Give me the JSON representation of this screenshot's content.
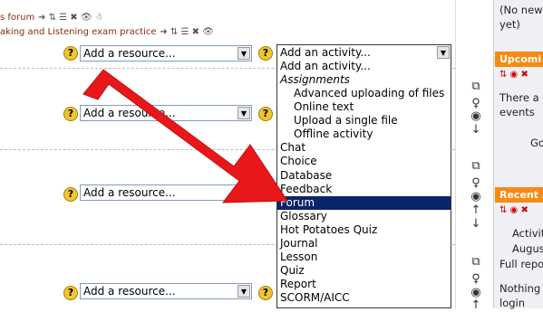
{
  "topbar": {
    "forum_link": "s forum",
    "practice_link": "aking and Listening exam practice",
    "edit_icons": "➜ ⇅ ☰ ✖ 👁",
    "edit_icons_short": "➜ ⇅ ☰ ✖ 👁 ☃"
  },
  "section_rows": [
    {
      "resource_label": "Add a resource...",
      "activity_label": "Add an activity..."
    },
    {
      "resource_label": "Add a resource...",
      "activity_label": "Add an activity..."
    },
    {
      "resource_label": "Add a resource...",
      "activity_label": "Add an activity..."
    },
    {
      "resource_label": "Add a resource...",
      "activity_label": "Add an activity..."
    }
  ],
  "help_symbol": "?",
  "dropdown": {
    "selected": "Add an activity...",
    "options": [
      {
        "label": "Add an activity...",
        "kind": "option"
      },
      {
        "label": "Assignments",
        "kind": "group"
      },
      {
        "label": "Advanced uploading of files",
        "kind": "sub"
      },
      {
        "label": "Online text",
        "kind": "sub"
      },
      {
        "label": "Upload a single file",
        "kind": "sub"
      },
      {
        "label": "Offline activity",
        "kind": "sub"
      },
      {
        "label": "Chat",
        "kind": "option"
      },
      {
        "label": "Choice",
        "kind": "option"
      },
      {
        "label": "Database",
        "kind": "option"
      },
      {
        "label": "Feedback",
        "kind": "option"
      },
      {
        "label": "Forum",
        "kind": "highlighted"
      },
      {
        "label": "Glossary",
        "kind": "option"
      },
      {
        "label": "Hot Potatoes Quiz",
        "kind": "option"
      },
      {
        "label": "Journal",
        "kind": "option"
      },
      {
        "label": "Lesson",
        "kind": "option"
      },
      {
        "label": "Quiz",
        "kind": "option"
      },
      {
        "label": "Report",
        "kind": "option"
      },
      {
        "label": "SCORM/AICC",
        "kind": "option"
      }
    ]
  },
  "right_block": {
    "news_text_1": "(No new",
    "news_text_2": "yet)",
    "upcoming_header": "Upcomi",
    "upcoming_text_1": "There a",
    "upcoming_text_2": "events",
    "upcoming_text_3": "Go",
    "recent_header": "Recent A",
    "recent_text_1": "Activit",
    "recent_text_2": "Augus",
    "recent_text_3": "Full repo",
    "recent_text_4": "Nothing",
    "recent_text_5": "login"
  },
  "colors": {
    "arrow": "#e8171a",
    "highlight": "#0a246a",
    "block_header": "#f78a10",
    "link": "#8a2b0c"
  }
}
